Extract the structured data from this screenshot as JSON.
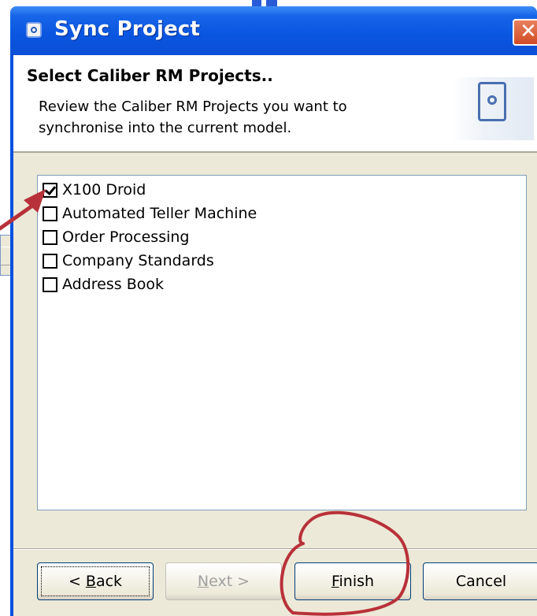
{
  "window": {
    "title": "Sync Project",
    "close_glyph": "✕"
  },
  "header": {
    "title": "Select Caliber RM Projects..",
    "description": "Review the Caliber RM Projects you want to synchronise into the current model."
  },
  "projects": [
    {
      "label": "X100 Droid",
      "checked": true
    },
    {
      "label": "Automated Teller Machine",
      "checked": false
    },
    {
      "label": "Order Processing",
      "checked": false
    },
    {
      "label": "Company Standards",
      "checked": false
    },
    {
      "label": "Address Book",
      "checked": false
    }
  ],
  "buttons": {
    "back": {
      "prefix": "< ",
      "mnemonic": "B",
      "rest": "ack"
    },
    "next": {
      "mnemonic": "N",
      "rest": "ext >"
    },
    "finish": {
      "mnemonic": "F",
      "rest": "inish"
    },
    "cancel": "Cancel"
  },
  "annotation_color": "#b8313a",
  "icons": [
    "app-icon",
    "close-icon",
    "sync-graphic-icon",
    "checkbox-icon"
  ]
}
